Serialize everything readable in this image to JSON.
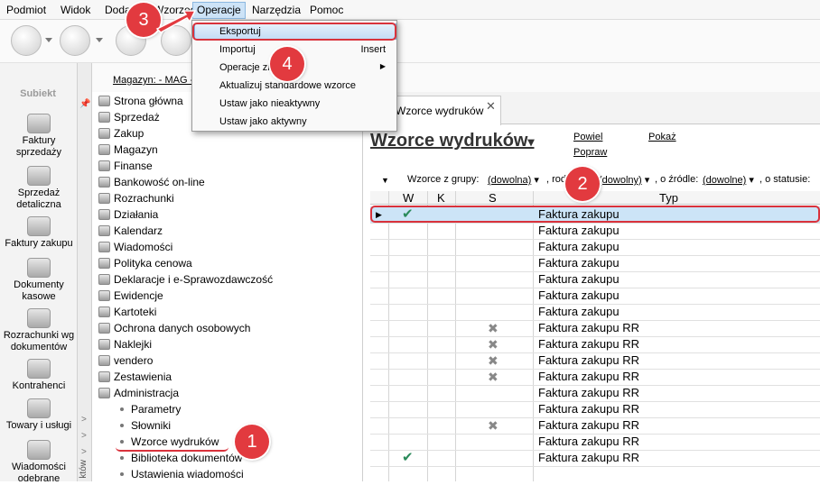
{
  "menubar": {
    "items": [
      "Podmiot",
      "Widok",
      "Dodaj",
      "Wzorzec",
      "Operacje",
      "Narzędzia",
      "Pomoc"
    ]
  },
  "dropdown": {
    "items": [
      {
        "label": "Eksportuj",
        "shortcut": ""
      },
      {
        "label": "Importuj",
        "shortcut": "Insert"
      },
      {
        "label": "Operacje zbiorcze",
        "shortcut": ""
      },
      {
        "label": "Aktualizuj standardowe wzorce",
        "shortcut": ""
      },
      {
        "label": "Ustaw jako nieaktywny",
        "shortcut": ""
      },
      {
        "label": "Ustaw jako aktywny",
        "shortcut": ""
      }
    ],
    "submenu_arrow": "▶"
  },
  "leftnav": {
    "logo": "Subiekt",
    "items": [
      "Faktury sprzedaży",
      "Sprzedaż detaliczna",
      "Faktury zakupu",
      "Dokumenty kasowe",
      "Rozrachunki wg dokumentów",
      "Kontrahenci",
      "Towary i usługi",
      "Wiadomości odebrane"
    ],
    "strip_label": "któw"
  },
  "magazyn": "Magazyn: - MAG -",
  "tree": {
    "nodes": [
      "Strona główna",
      "Sprzedaż",
      "Zakup",
      "Magazyn",
      "Finanse",
      "Bankowość on-line",
      "Rozrachunki",
      "Działania",
      "Kalendarz",
      "Wiadomości",
      "Polityka cenowa",
      "Deklaracje i e-Sprawozdawczość",
      "Ewidencje",
      "Kartoteki",
      "Ochrona danych osobowych",
      "Naklejki",
      "vendero",
      "Zestawienia",
      "Administracja"
    ],
    "subnodes": [
      "Parametry",
      "Słowniki",
      "Wzorce wydruków",
      "Biblioteka dokumentów",
      "Ustawienia wiadomości"
    ]
  },
  "tab": {
    "label": "Wzorce wydruków",
    "close": "✕"
  },
  "page": {
    "title": "Wzorce wydruków",
    "title_arrow": "▾",
    "links": {
      "new": "Powiel",
      "fix": "Popraw",
      "show": "Pokaż"
    }
  },
  "filters": {
    "group_label": "Wzorce z grupy:",
    "group_value": "(dowolna)",
    "kind_label": ", rodzaj",
    "kind_value": "(dowolny)",
    "source_label": ", o źródle:",
    "source_value": "(dowolne)",
    "status_label": ", o statusie:"
  },
  "grid": {
    "columns": [
      "W",
      "K",
      "S",
      "Typ"
    ],
    "rows": [
      {
        "w": "check",
        "k": "",
        "s": "",
        "typ": "Faktura zakupu"
      },
      {
        "w": "",
        "k": "",
        "s": "",
        "typ": "Faktura zakupu"
      },
      {
        "w": "",
        "k": "",
        "s": "",
        "typ": "Faktura zakupu"
      },
      {
        "w": "",
        "k": "",
        "s": "",
        "typ": "Faktura zakupu"
      },
      {
        "w": "",
        "k": "",
        "s": "",
        "typ": "Faktura zakupu"
      },
      {
        "w": "",
        "k": "",
        "s": "",
        "typ": "Faktura zakupu"
      },
      {
        "w": "",
        "k": "",
        "s": "",
        "typ": "Faktura zakupu"
      },
      {
        "w": "",
        "k": "",
        "s": "x",
        "typ": "Faktura zakupu RR"
      },
      {
        "w": "",
        "k": "",
        "s": "x",
        "typ": "Faktura zakupu RR"
      },
      {
        "w": "",
        "k": "",
        "s": "x",
        "typ": "Faktura zakupu RR"
      },
      {
        "w": "",
        "k": "",
        "s": "x",
        "typ": "Faktura zakupu RR"
      },
      {
        "w": "",
        "k": "",
        "s": "",
        "typ": "Faktura zakupu RR"
      },
      {
        "w": "",
        "k": "",
        "s": "",
        "typ": "Faktura zakupu RR"
      },
      {
        "w": "",
        "k": "",
        "s": "x",
        "typ": "Faktura zakupu RR"
      },
      {
        "w": "",
        "k": "",
        "s": "",
        "typ": "Faktura zakupu RR"
      },
      {
        "w": "check",
        "k": "",
        "s": "",
        "typ": "Faktura zakupu RR"
      }
    ],
    "check_glyph": "✔",
    "x_glyph": "✖",
    "row_pointer": "▶"
  },
  "badges": [
    "1",
    "2",
    "3",
    "4"
  ],
  "colors": {
    "accent": "#d9323c",
    "selection": "#cce4f7",
    "check": "#2a8a5a"
  }
}
